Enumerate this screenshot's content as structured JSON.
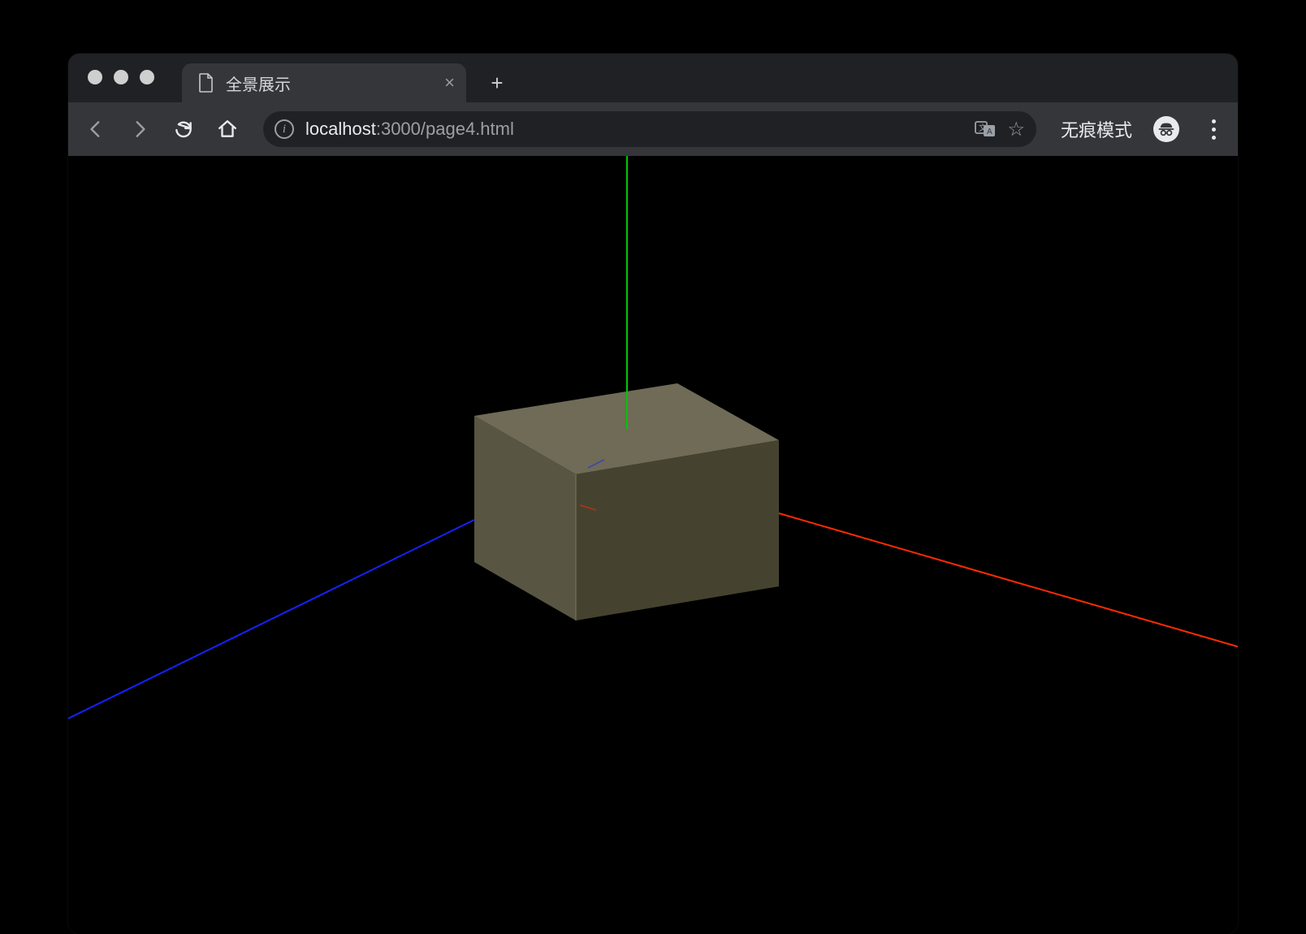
{
  "browser": {
    "tab": {
      "title": "全景展示",
      "close_label": "×"
    },
    "new_tab_label": "+",
    "toolbar": {
      "url_host": "localhost",
      "url_rest": ":3000/page4.html",
      "incognito_label": "无痕模式"
    }
  },
  "scene": {
    "background": "#000000",
    "axes": {
      "x_color": "#ff2b00",
      "y_color": "#00c800",
      "z_color": "#1522ff"
    },
    "box": {
      "color_top": "#6f6b57",
      "color_front": "#585542",
      "color_right": "#45432f",
      "edge": "#000000"
    },
    "geometry_note": "Orthographic-ish view of a rectangular box at origin with XYZ axis helper lines. Y up (green), X to right (red), Z toward camera-left (blue)."
  }
}
